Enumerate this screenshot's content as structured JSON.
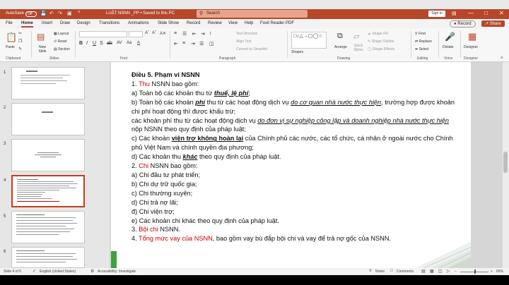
{
  "titlebar": {
    "autosave": "AutoSave",
    "autosave_state": "Off",
    "doc_title": "LUẬT NSNN _PP  •  Saved to this PC",
    "search_placeholder": "Search",
    "sign_in": "Sign in",
    "accent": "#b7472a"
  },
  "menu": {
    "tabs": [
      "File",
      "Home",
      "Insert",
      "Draw",
      "Design",
      "Transitions",
      "Animations",
      "Slide Show",
      "Record",
      "Review",
      "View",
      "Help",
      "Foxit Reader PDF"
    ],
    "record_label": "Record",
    "share_label": "Share"
  },
  "ribbon": {
    "clipboard": {
      "paste": "Paste",
      "group": "Clipboard"
    },
    "slides": {
      "new_slide": "New Slide",
      "layout": "Layout",
      "reset": "Reset",
      "section": "Section",
      "group": "Slides"
    },
    "font": {
      "group": "Font"
    },
    "paragraph": {
      "text_direction": "Text Direction",
      "align_text": "Align Text",
      "smartart": "Convert to SmartArt",
      "group": "Paragraph"
    },
    "drawing": {
      "shapes": "Shapes",
      "arrange": "Arrange",
      "quick_styles": "Quick Styles",
      "shape_fill": "Shape Fill",
      "shape_outline": "Shape Outline",
      "shape_effects": "Shape Effects",
      "group": "Drawing"
    },
    "editing": {
      "find": "Find",
      "replace": "Replace",
      "select": "Select",
      "group": "Editing"
    },
    "voice": {
      "dictate": "Dictate",
      "group": "Voice"
    },
    "designer": {
      "label": "Designer",
      "group": "Designer"
    }
  },
  "thumbnails": [
    {
      "number": "1",
      "selected": false
    },
    {
      "number": "2",
      "selected": false
    },
    {
      "number": "3",
      "selected": false
    },
    {
      "number": "4",
      "selected": true
    },
    {
      "number": "5",
      "selected": false
    },
    {
      "number": "6",
      "selected": false
    }
  ],
  "slide": {
    "heading": "Điều 5. Phạm vi NSNN",
    "l1_num": "1. ",
    "l1_red": "Thu",
    "l1_rest": " NSNN bao gồm:",
    "a_pre": "a) Toàn bộ các khoản thu từ ",
    "a_em": "thuế, lệ phí",
    "a_post": ";",
    "b_pre": "b) Toàn bộ các khoản ",
    "b_em": "phí",
    "b_mid": " thu từ các hoạt động dịch vụ ",
    "b_u": "do cơ quan nhà nước thực hiện",
    "b_post": ", trường hợp được khoản chi phí hoạt động thì được khấu trừ;",
    "c_pre": "các khoản phí thu từ các hoạt động dịch vụ ",
    "c_u": "do đơn vị sự nghiệp công lập và doanh nghiệp nhà nước thực hiện",
    "c_post": " nộp NSNN theo quy định của pháp luật;",
    "cc_pre": "c) Các khoản ",
    "cc_em": "viện trợ không hoàn lại",
    "cc_post": " của Chính phủ các nước, các tổ chức, cá nhân ở ngoài nước cho Chính phủ Việt Nam và chính quyền địa phương;",
    "d_pre": "d) Các khoản thu ",
    "d_em": "khác",
    "d_post": " theo quy định của pháp luật.",
    "l2_num": "2. ",
    "l2_red": "Chi",
    "l2_rest": " NSNN bao gồm:",
    "i2a": "a) Chi đầu tư phát triển;",
    "i2b": "b) Chi dự trữ quốc gia;",
    "i2c": "c) Chi thường xuyên;",
    "i2d": "d) Chi trả nợ lãi;",
    "i2dd": "đ) Chi viện trợ;",
    "i2e": "e) Các khoản chi khác theo quy định của pháp luật.",
    "l3_num": "3. ",
    "l3_red": "Bội chi",
    "l3_rest": " NSNN.",
    "l4_num": "4. ",
    "l4_red": "Tổng mức vay của NSNN",
    "l4_rest": ", bao gồm vay bù đắp bội chi và vay để trả nợ gốc của NSNN."
  },
  "status": {
    "slide_of": "Slide 4 of 6",
    "language": "English (United States)",
    "accessibility": "Accessibility: Investigate",
    "notes": "Notes",
    "comments": "Comments",
    "zoom": "65%"
  }
}
